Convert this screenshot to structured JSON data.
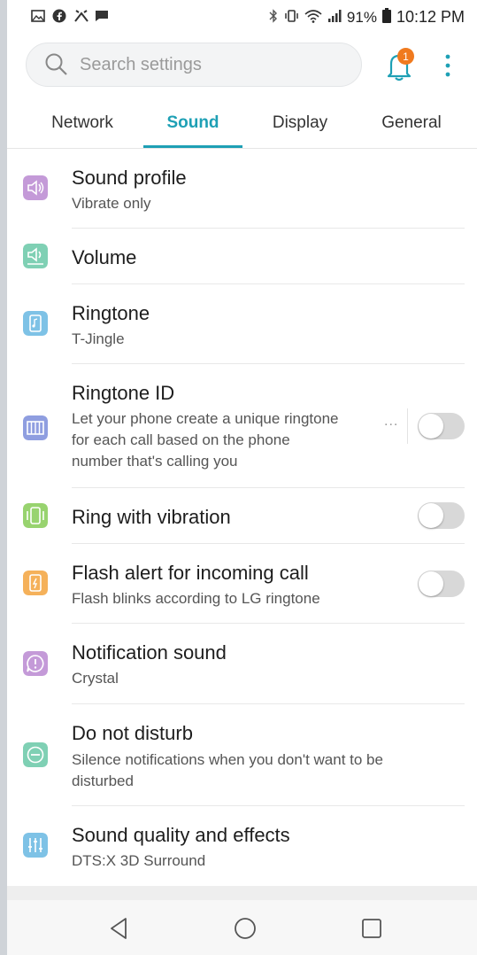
{
  "statusbar": {
    "left_icons": [
      "image-icon",
      "facebook-icon",
      "alarm-icon",
      "message-icon"
    ],
    "battery_text": "91%",
    "time": "10:12 PM"
  },
  "search": {
    "placeholder": "Search settings"
  },
  "notifications": {
    "badge_count": "1"
  },
  "tabs": [
    {
      "label": "Network",
      "active": false
    },
    {
      "label": "Sound",
      "active": true
    },
    {
      "label": "Display",
      "active": false
    },
    {
      "label": "General",
      "active": false
    }
  ],
  "settings": [
    {
      "title": "Sound profile",
      "subtitle": "Vibrate only",
      "icon": "speaker-icon",
      "icon_color": "#c49ad8"
    },
    {
      "title": "Volume",
      "subtitle": "",
      "icon": "volume-icon",
      "icon_color": "#7fd0b4"
    },
    {
      "title": "Ringtone",
      "subtitle": "T-Jingle",
      "icon": "ringtone-icon",
      "icon_color": "#7ec2e6"
    },
    {
      "title": "Ringtone ID",
      "subtitle_lines": [
        "Let your phone create a unique ringtone",
        "for each call based on the phone",
        "number that's calling you"
      ],
      "icon": "piano-icon",
      "icon_color": "#8f9ee0",
      "toggle": false,
      "more": "..."
    },
    {
      "title": "Ring with vibration",
      "subtitle": "",
      "icon": "vibration-icon",
      "icon_color": "#98d36f",
      "toggle": false
    },
    {
      "title": "Flash alert for incoming call",
      "subtitle": "Flash blinks according to LG ringtone",
      "icon": "flash-alert-icon",
      "icon_color": "#f5b15a",
      "toggle": false
    },
    {
      "title": "Notification sound",
      "subtitle": "Crystal",
      "icon": "notification-icon",
      "icon_color": "#c49ad8"
    },
    {
      "title": "Do not disturb",
      "subtitle_lines": [
        "Silence notifications when you don't want to be",
        "disturbed"
      ],
      "icon": "do-not-disturb-icon",
      "icon_color": "#7fd0b4"
    },
    {
      "title": "Sound quality and effects",
      "subtitle": "DTS:X 3D Surround",
      "icon": "equalizer-icon",
      "icon_color": "#7ec2e6"
    }
  ],
  "navbar": {
    "buttons": [
      "back-icon",
      "home-icon",
      "recents-icon"
    ]
  }
}
